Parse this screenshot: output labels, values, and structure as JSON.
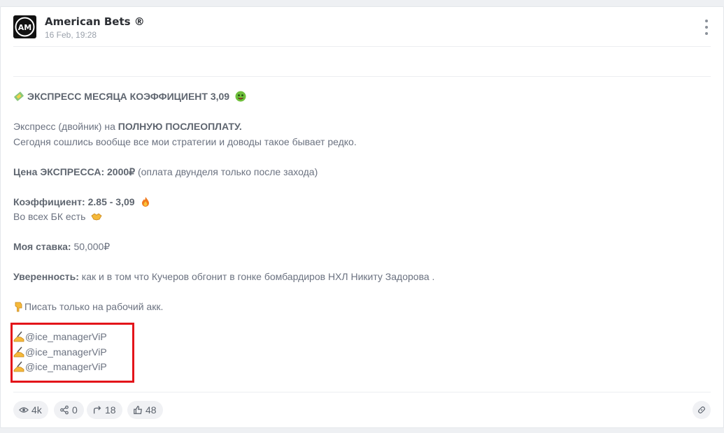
{
  "channel": {
    "name": "American Bets ®",
    "date": "16 Feb, 19:28",
    "avatar_text": "AM"
  },
  "post": {
    "title": "ЭКСПРЕСС МЕСЯЦА КОЭФФИЦИЕНТ 3,09",
    "intro_a": "Экспресс (двойник) на ",
    "intro_b": "ПОЛНУЮ ПОСЛЕОПЛАТУ.",
    "intro_line2": "Сегодня сошлись вообще все мои стратегии и доводы такое бывает редко.",
    "price_label": "Цена ЭКСПРЕССА: 2000₽",
    "price_note": " (оплата двунделя только после захода)",
    "coef_label": "Коэффициент: 2.85 - 3,09",
    "bk_text": "Во всех БК есть",
    "stake_label": "Моя ставка:",
    "stake_value": " 50,000₽",
    "confidence_label": "Уверенность:",
    "confidence_text": " как и в том что Кучеров обгонит в гонке бомбардиров НХЛ Никиту Задорова .",
    "write_text": "Писать только на рабочий акк.",
    "contacts": [
      "@ice_managerViP",
      "@ice_managerViP",
      "@ice_managerViP"
    ]
  },
  "stats": {
    "views": "4k",
    "shares": "0",
    "forwards": "18",
    "likes": "48"
  },
  "icons": {
    "title_left": "pencil-emoji",
    "title_right": "money-face-emoji",
    "coef": "fire-emoji",
    "bk": "handshake-emoji",
    "write": "point-down-emoji",
    "contact": "writing-hand-emoji"
  }
}
